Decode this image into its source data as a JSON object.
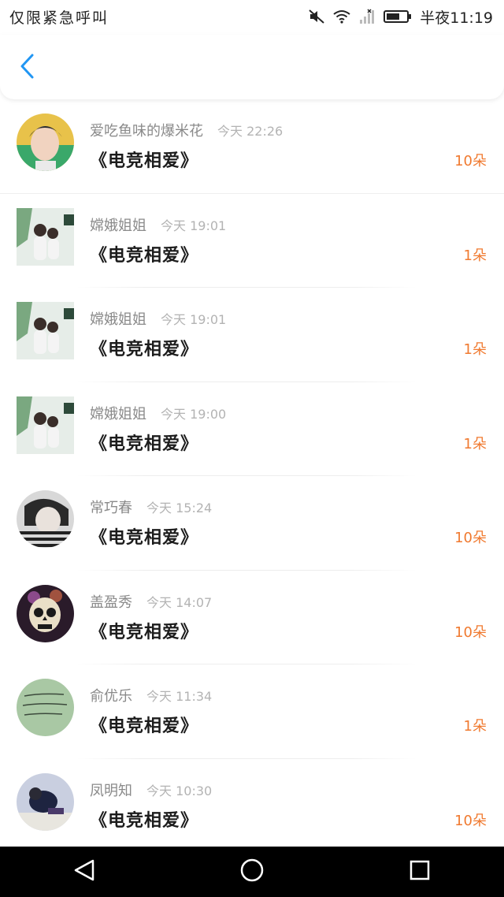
{
  "status_bar": {
    "carrier_text": "仅限紧急呼叫",
    "time": "半夜11:19",
    "icons": [
      "mute-icon",
      "wifi-icon",
      "signal-icon",
      "battery-icon"
    ]
  },
  "header": {
    "back_icon": "chevron-left-icon",
    "accent_color": "#2196f3"
  },
  "colors": {
    "count_color": "#f07a30",
    "name_color": "#8a8a8a",
    "time_color": "#b3b3b3"
  },
  "items": [
    {
      "name": "爱吃鱼味的爆米花",
      "time": "今天 22:26",
      "title": "《电竞相爱》",
      "count": "10朵",
      "avatar": "round"
    },
    {
      "name": "嫦娥姐姐",
      "time": "今天 19:01",
      "title": "《电竞相爱》",
      "count": "1朵",
      "avatar": "square"
    },
    {
      "name": "嫦娥姐姐",
      "time": "今天 19:01",
      "title": "《电竞相爱》",
      "count": "1朵",
      "avatar": "square"
    },
    {
      "name": "嫦娥姐姐",
      "time": "今天 19:00",
      "title": "《电竞相爱》",
      "count": "1朵",
      "avatar": "square"
    },
    {
      "name": "常巧春",
      "time": "今天 15:24",
      "title": "《电竞相爱》",
      "count": "10朵",
      "avatar": "round"
    },
    {
      "name": "盖盈秀",
      "time": "今天 14:07",
      "title": "《电竞相爱》",
      "count": "10朵",
      "avatar": "round"
    },
    {
      "name": "俞优乐",
      "time": "今天 11:34",
      "title": "《电竞相爱》",
      "count": "1朵",
      "avatar": "round"
    },
    {
      "name": "凤明知",
      "time": "今天 10:30",
      "title": "《电竞相爱》",
      "count": "10朵",
      "avatar": "round"
    }
  ],
  "nav_bar": {
    "buttons": [
      "back-triangle-icon",
      "home-circle-icon",
      "recents-square-icon"
    ]
  }
}
